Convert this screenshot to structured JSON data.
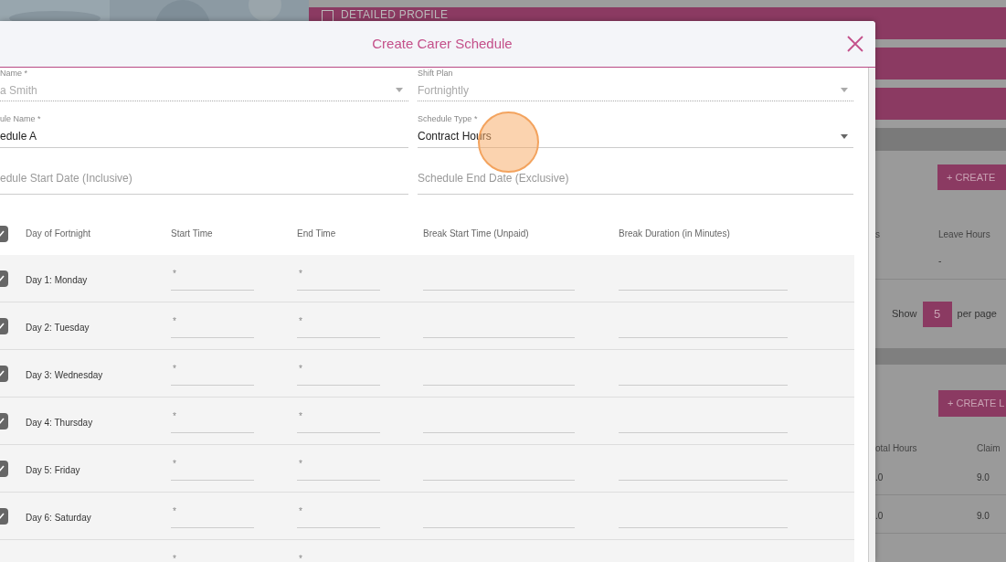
{
  "background": {
    "profile_bar": {
      "label": "DETAILED PROFILE"
    },
    "work_section": {
      "button": "+ CREATE",
      "columns": [
        "s",
        "Leave Hours"
      ],
      "row": [
        "-"
      ],
      "show_label": "Show",
      "per_page": "5",
      "per_page_label": "per page"
    },
    "leave_section": {
      "button": "+ CREATE L",
      "columns": [
        "otal Hours",
        "Claim"
      ],
      "rows": [
        [
          ".0",
          "9.0"
        ],
        [
          ".0",
          "9.0"
        ]
      ]
    }
  },
  "modal": {
    "title": "Create Carer Schedule",
    "fields": [
      {
        "kind": "select",
        "label": "Name *",
        "value": "a Smith",
        "disabled": true
      },
      {
        "kind": "select",
        "label": "Shift Plan",
        "value": "Fortnightly",
        "disabled": true
      },
      {
        "kind": "text",
        "label": "ule Name *",
        "value": "edule A",
        "disabled": false
      },
      {
        "kind": "select",
        "label": "Schedule Type *",
        "value": "Contract Hours",
        "disabled": false
      },
      {
        "kind": "date",
        "placeholder": "edule Start Date (Inclusive)"
      },
      {
        "kind": "date",
        "placeholder": "Schedule End Date (Exclusive)"
      }
    ],
    "table": {
      "all_checked": true,
      "columns": [
        "Day of Fortnight",
        "Start Time",
        "End Time",
        "Break Start Time (Unpaid)",
        "Break Duration (in Minutes)"
      ],
      "rows": [
        {
          "day": "Day 1: Monday",
          "checked": true,
          "start": "*",
          "end": "*"
        },
        {
          "day": "Day 2: Tuesday",
          "checked": true,
          "start": "*",
          "end": "*"
        },
        {
          "day": "Day 3: Wednesday",
          "checked": true,
          "start": "*",
          "end": "*"
        },
        {
          "day": "Day 4: Thursday",
          "checked": true,
          "start": "*",
          "end": "*"
        },
        {
          "day": "Day 5: Friday",
          "checked": true,
          "start": "*",
          "end": "*"
        },
        {
          "day": "Day 6: Saturday",
          "checked": true,
          "start": "*",
          "end": "*"
        },
        {
          "start": "*",
          "end": "*"
        }
      ]
    }
  }
}
